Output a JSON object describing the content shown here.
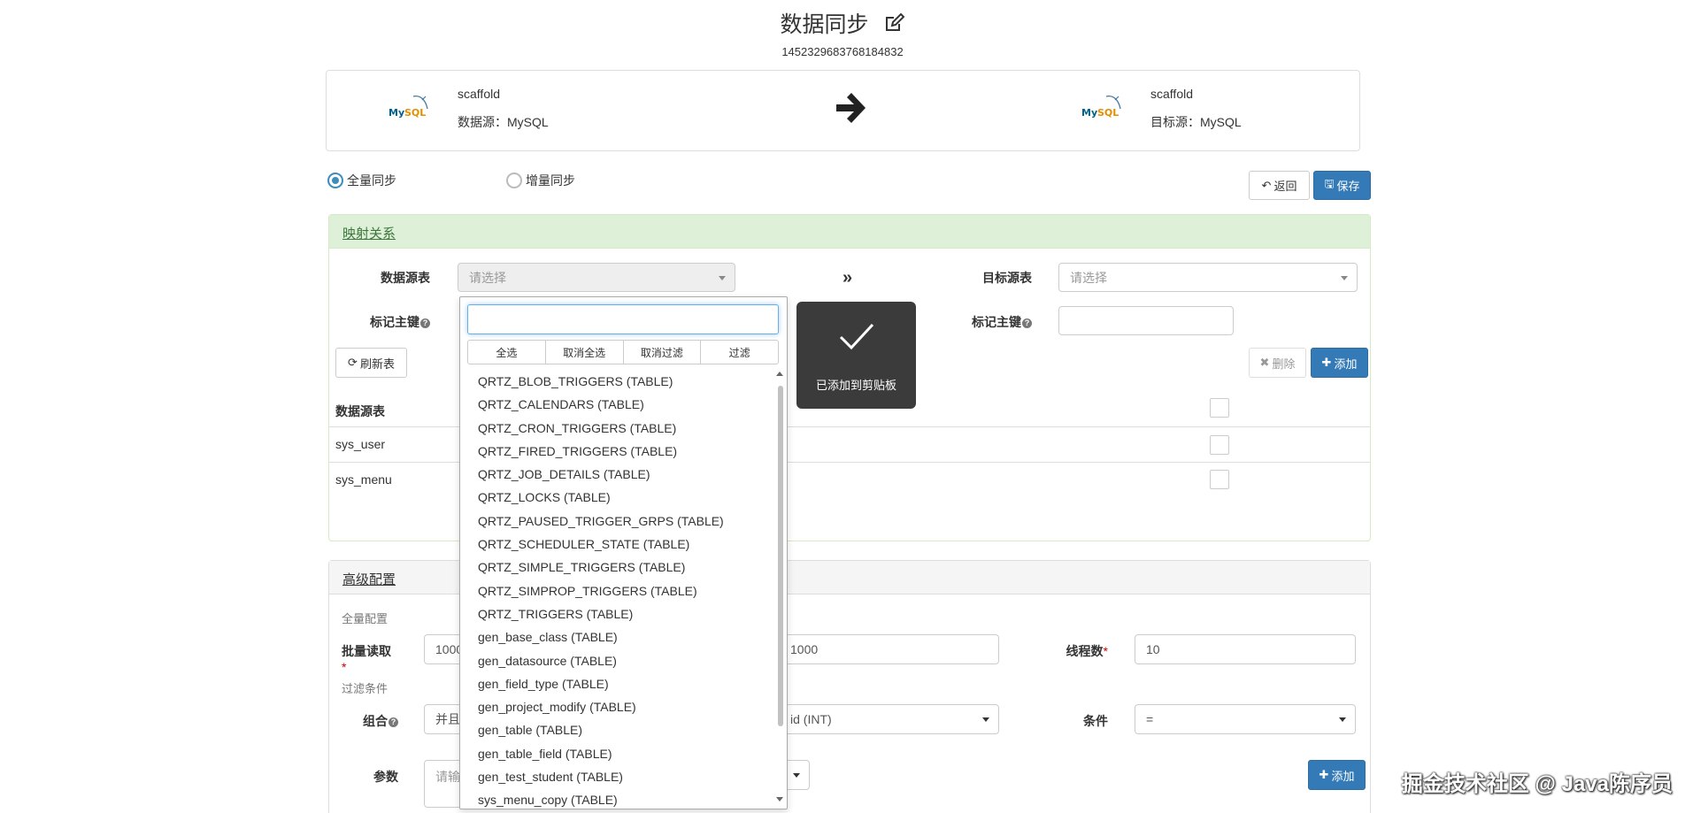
{
  "header": {
    "title": "数据同步",
    "job_id": "1452329683768184832"
  },
  "source": {
    "logo_text": "MySQL",
    "name": "scaffold",
    "type_label": "数据源：MySQL"
  },
  "target": {
    "logo_text": "MySQL",
    "name": "scaffold",
    "type_label": "目标源：MySQL"
  },
  "sync_mode": {
    "full_label": "全量同步",
    "incremental_label": "增量同步",
    "selected": "full"
  },
  "actions": {
    "back_label": "返回",
    "save_label": "保存"
  },
  "mapping": {
    "title": "映射关系",
    "source_table_label": "数据源表",
    "source_table_placeholder": "请选择",
    "target_table_label": "目标源表",
    "target_table_placeholder": "请选择",
    "source_pk_label": "标记主键",
    "target_pk_label": "标记主键",
    "refresh_label": "刷新表",
    "delete_label": "删除",
    "add_label": "添加",
    "table_header_source": "数据源表",
    "rows": [
      {
        "source": "sys_user"
      },
      {
        "source": "sys_menu"
      }
    ]
  },
  "dropdown": {
    "search_value": "",
    "buttons": [
      "全选",
      "取消全选",
      "取消过滤",
      "过滤"
    ],
    "items": [
      "QRTZ_BLOB_TRIGGERS (TABLE)",
      "QRTZ_CALENDARS (TABLE)",
      "QRTZ_CRON_TRIGGERS (TABLE)",
      "QRTZ_FIRED_TRIGGERS (TABLE)",
      "QRTZ_JOB_DETAILS (TABLE)",
      "QRTZ_LOCKS (TABLE)",
      "QRTZ_PAUSED_TRIGGER_GRPS (TABLE)",
      "QRTZ_SCHEDULER_STATE (TABLE)",
      "QRTZ_SIMPLE_TRIGGERS (TABLE)",
      "QRTZ_SIMPROP_TRIGGERS (TABLE)",
      "QRTZ_TRIGGERS (TABLE)",
      "gen_base_class (TABLE)",
      "gen_datasource (TABLE)",
      "gen_field_type (TABLE)",
      "gen_project_modify (TABLE)",
      "gen_table (TABLE)",
      "gen_table_field (TABLE)",
      "gen_test_student (TABLE)",
      "sys_menu_copy (TABLE)"
    ]
  },
  "toast": {
    "message": "已添加到剪贴板"
  },
  "advanced": {
    "title": "高级配置",
    "full_config_label": "全量配置",
    "batch_read_label": "批量读取",
    "batch_read_value": "1000",
    "batch_write_value": "1000",
    "threads_label": "线程数",
    "threads_value": "10",
    "filter_label": "过滤条件",
    "combine_label": "组合",
    "combine_value": "并且",
    "field_value": "id (INT)",
    "condition_label": "条件",
    "condition_value": "=",
    "param_label": "参数",
    "param_placeholder": "请输",
    "add_label": "添加"
  },
  "watermark": "掘金技术社区 @ Java陈序员"
}
